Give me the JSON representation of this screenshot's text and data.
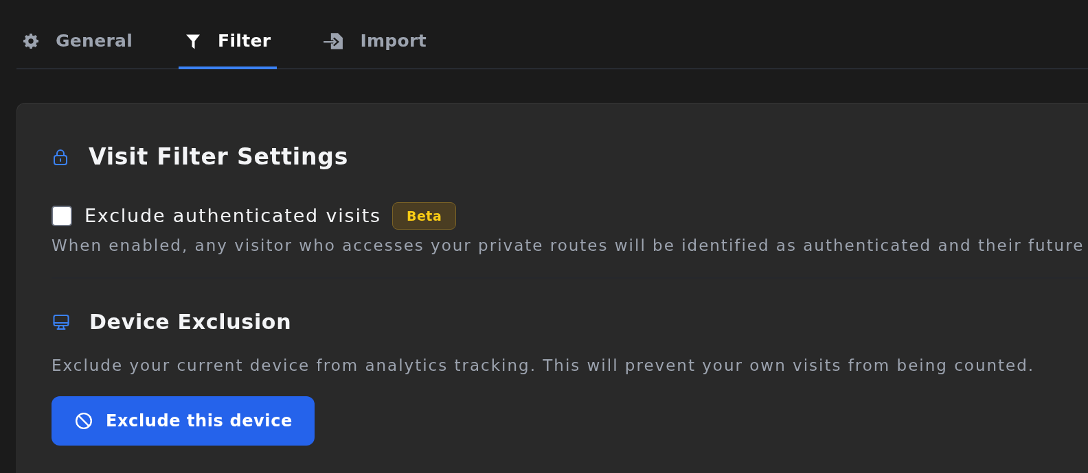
{
  "tabs": [
    {
      "label": "General",
      "selected": false
    },
    {
      "label": "Filter",
      "selected": true
    },
    {
      "label": "Import",
      "selected": false
    }
  ],
  "visit_filter": {
    "title": "Visit Filter Settings",
    "option": {
      "label": "Exclude authenticated visits",
      "checked": false,
      "badge": "Beta"
    },
    "description": "When enabled, any visitor who accesses your private routes will be identified as authenticated and their future"
  },
  "device_exclusion": {
    "title": "Device Exclusion",
    "description": "Exclude your current device from analytics tracking. This will prevent your own visits from being counted.",
    "button": {
      "label": "Exclude this device"
    }
  }
}
